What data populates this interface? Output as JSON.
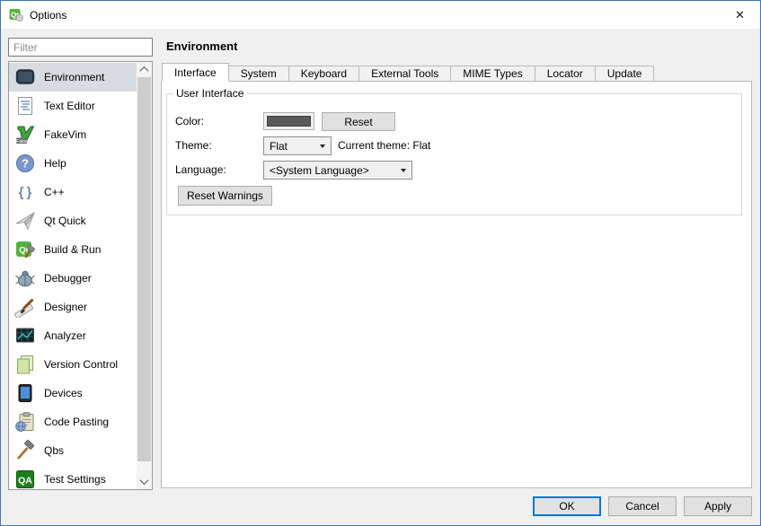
{
  "window": {
    "title": "Options",
    "close_glyph": "✕"
  },
  "colors": {
    "dialog_border": "#3a79b8",
    "body_bg": "#f0f0f0",
    "selection_bg": "#d8dbdf",
    "ok_focus_border": "#0078d7",
    "swatch_color": "#595959",
    "qt_green": "#54b33e"
  },
  "sidebar": {
    "filter_placeholder": "Filter",
    "items": [
      {
        "label": "Environment",
        "icon": "environment-icon",
        "selected": true
      },
      {
        "label": "Text Editor",
        "icon": "text-editor-icon",
        "selected": false
      },
      {
        "label": "FakeVim",
        "icon": "fakevim-icon",
        "selected": false
      },
      {
        "label": "Help",
        "icon": "help-icon",
        "selected": false
      },
      {
        "label": "C++",
        "icon": "cpp-icon",
        "selected": false
      },
      {
        "label": "Qt Quick",
        "icon": "qt-quick-icon",
        "selected": false
      },
      {
        "label": "Build & Run",
        "icon": "build-run-icon",
        "selected": false
      },
      {
        "label": "Debugger",
        "icon": "debugger-icon",
        "selected": false
      },
      {
        "label": "Designer",
        "icon": "designer-icon",
        "selected": false
      },
      {
        "label": "Analyzer",
        "icon": "analyzer-icon",
        "selected": false
      },
      {
        "label": "Version Control",
        "icon": "version-control-icon",
        "selected": false
      },
      {
        "label": "Devices",
        "icon": "devices-icon",
        "selected": false
      },
      {
        "label": "Code Pasting",
        "icon": "code-pasting-icon",
        "selected": false
      },
      {
        "label": "Qbs",
        "icon": "qbs-icon",
        "selected": false
      },
      {
        "label": "Test Settings",
        "icon": "test-settings-icon",
        "selected": false
      }
    ]
  },
  "main": {
    "heading": "Environment",
    "tabs": [
      {
        "label": "Interface",
        "active": true
      },
      {
        "label": "System",
        "active": false
      },
      {
        "label": "Keyboard",
        "active": false
      },
      {
        "label": "External Tools",
        "active": false
      },
      {
        "label": "MIME Types",
        "active": false
      },
      {
        "label": "Locator",
        "active": false
      },
      {
        "label": "Update",
        "active": false
      }
    ],
    "group": {
      "title": "User Interface",
      "color_label": "Color:",
      "reset_button": "Reset",
      "theme_label": "Theme:",
      "theme_value": "Flat",
      "current_theme_text": "Current theme: Flat",
      "language_label": "Language:",
      "language_value": "<System Language>",
      "reset_warnings_button": "Reset Warnings"
    }
  },
  "footer": {
    "ok": "OK",
    "cancel": "Cancel",
    "apply": "Apply"
  }
}
